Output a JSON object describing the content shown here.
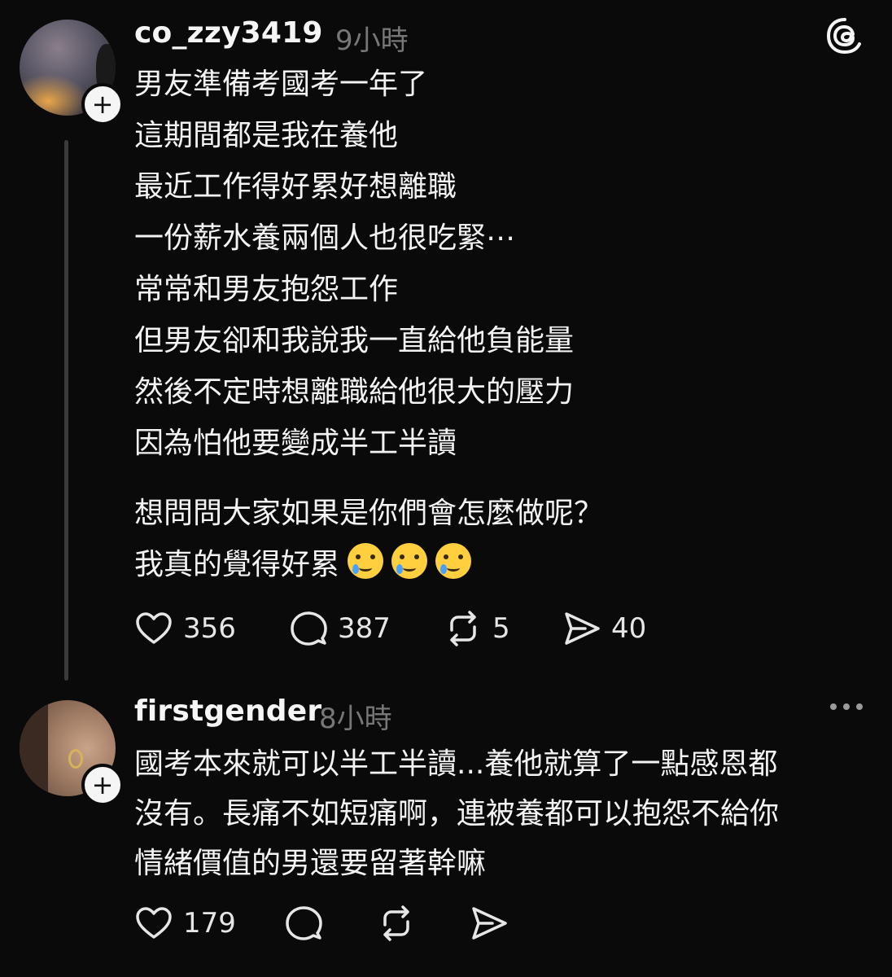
{
  "post": {
    "username": "co_zzy3419",
    "time": "9小時",
    "lines": [
      "男友準備考國考一年了",
      "這期間都是我在養他",
      "最近工作得好累好想離職",
      "一份薪水養兩個人也很吃緊⋯",
      "常常和男友抱怨工作",
      "但男友卻和我說我一直給他負能量",
      "然後不定時想離職給他很大的壓力",
      "因為怕他要變成半工半讀"
    ],
    "lines2": [
      "想問問大家如果是你們會怎麼做呢？",
      "我真的覺得好累"
    ],
    "emoji_names": [
      "crying-face-emoji",
      "crying-face-emoji",
      "crying-face-emoji"
    ],
    "likes": "356",
    "comments": "387",
    "reposts": "5",
    "shares": "40"
  },
  "reply": {
    "username": "firstgender",
    "time": "8小時",
    "lines": [
      "國考本來就可以半工半讀...養他就算了一點感恩都",
      "沒有。長痛不如短痛啊，連被養都可以抱怨不給你",
      "情緒價值的男還要留著幹嘛"
    ],
    "likes": "179"
  },
  "icons": {
    "like": "heart-icon",
    "comment": "comment-icon",
    "repost": "repost-icon",
    "share": "share-icon",
    "app": "threads-logo-icon",
    "more": "more-icon",
    "follow": "plus-icon"
  }
}
